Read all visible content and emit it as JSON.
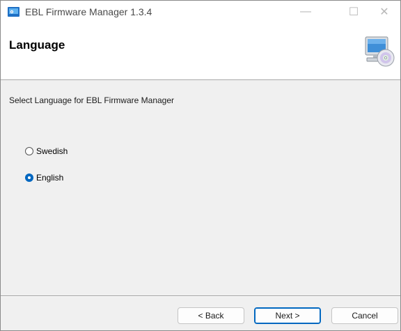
{
  "window": {
    "title": "EBL Firmware Manager 1.3.4",
    "minimize_glyph": "—",
    "maximize_glyph": "☐",
    "close_glyph": "✕"
  },
  "header": {
    "title": "Language",
    "icon": "computer-cd-icon"
  },
  "main": {
    "instruction": "Select Language for EBL Firmware Manager",
    "options": [
      {
        "label": "Swedish",
        "selected": false
      },
      {
        "label": "English",
        "selected": true
      }
    ]
  },
  "footer": {
    "back_label": "< Back",
    "next_label": "Next >",
    "cancel_label": "Cancel"
  },
  "colors": {
    "accent": "#0067c0"
  }
}
